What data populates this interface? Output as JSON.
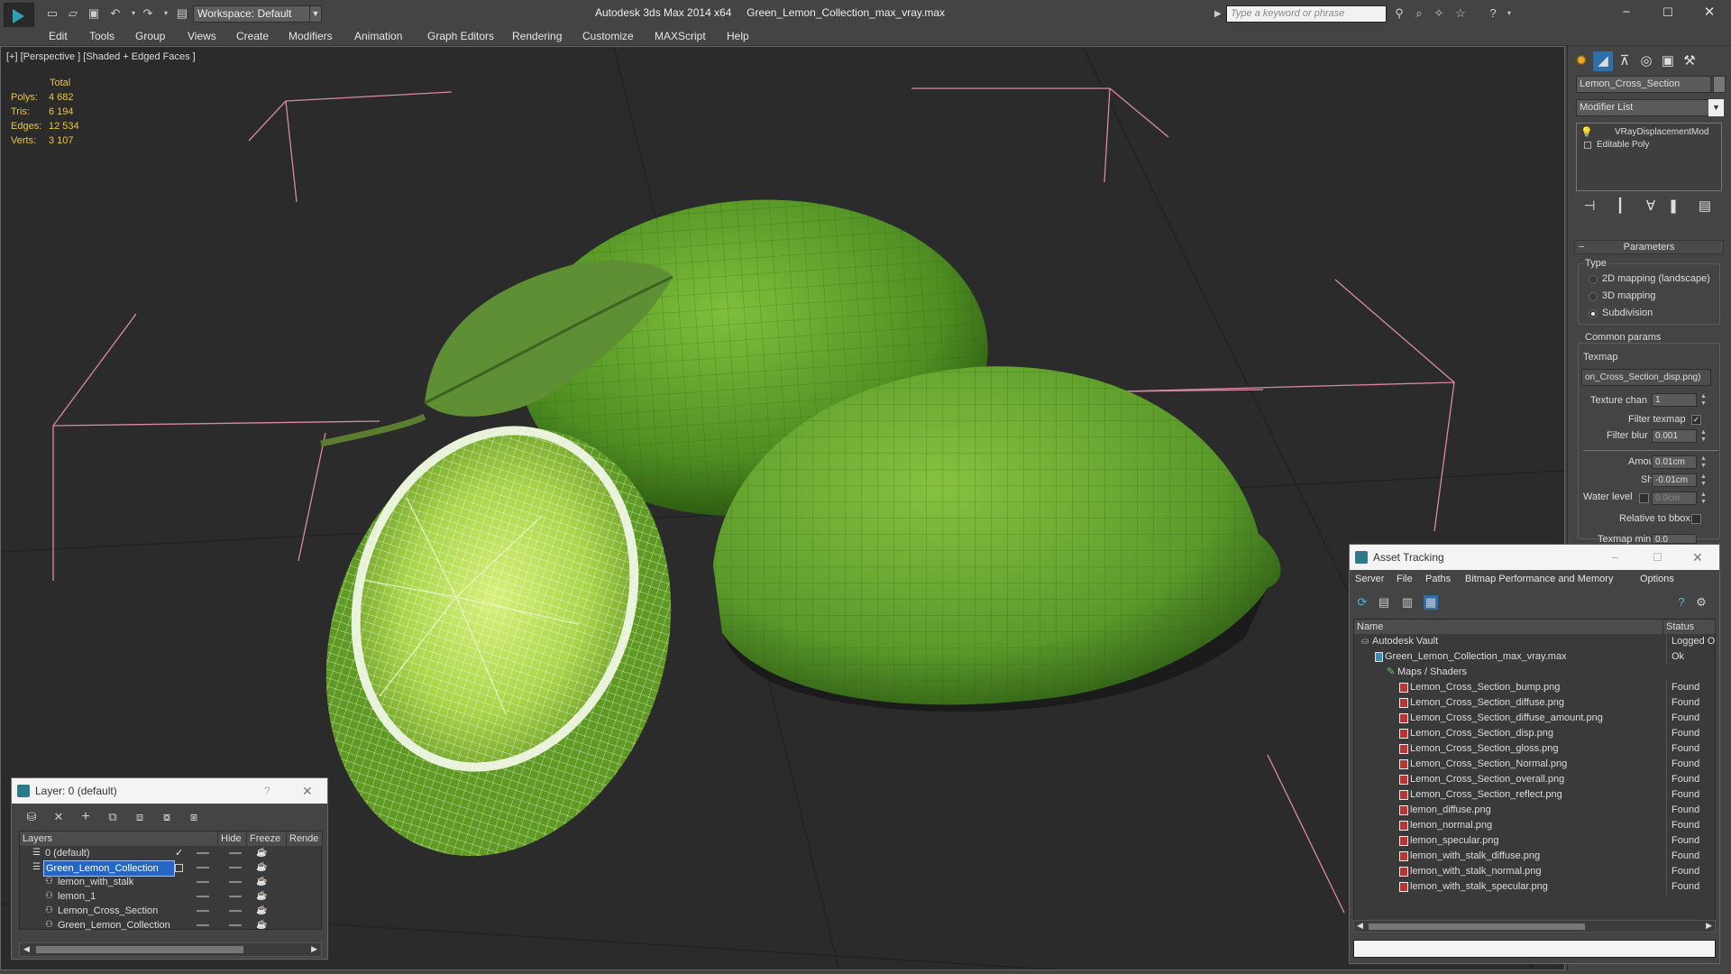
{
  "app": {
    "title": "Autodesk 3ds Max 2014 x64",
    "file": "Green_Lemon_Collection_max_vray.max",
    "workspace": "Workspace: Default",
    "search_placeholder": "Type a keyword or phrase"
  },
  "menu": [
    "Edit",
    "Tools",
    "Group",
    "Views",
    "Create",
    "Modifiers",
    "Animation",
    "Graph Editors",
    "Rendering",
    "Customize",
    "MAXScript",
    "Help"
  ],
  "viewport": {
    "label": "[+] [Perspective ] [Shaded + Edged Faces ]",
    "stats": {
      "header": "Total",
      "rows": [
        {
          "label": "Polys:",
          "value": "4 682"
        },
        {
          "label": "Tris:",
          "value": "6 194"
        },
        {
          "label": "Edges:",
          "value": "12 534"
        },
        {
          "label": "Verts:",
          "value": "3 107"
        }
      ]
    }
  },
  "command_panel": {
    "object_name": "Lemon_Cross_Section",
    "modifier_list": "Modifier List",
    "stack": [
      "VRayDisplacementMod",
      "Editable Poly"
    ],
    "parameters_title": "Parameters",
    "type_label": "Type",
    "type_options": [
      "2D mapping (landscape)",
      "3D mapping",
      "Subdivision"
    ],
    "type_selected": "Subdivision",
    "common_params": "Common params",
    "texmap_label": "Texmap",
    "texmap_value": "on_Cross_Section_disp.png)",
    "texture_chan_label": "Texture chan",
    "texture_chan_value": "1",
    "filter_texmap_label": "Filter texmap",
    "filter_texmap_checked": true,
    "filter_blur_label": "Filter blur",
    "filter_blur_value": "0.001",
    "amount_label": "Amount",
    "amount_value": "0.01cm",
    "shift_label": "Shift",
    "shift_value": "-0.01cm",
    "water_level_label": "Water level",
    "water_level_value": "0.0cm",
    "relative_bbox_label": "Relative to bbox",
    "texmap_min_label": "Texmap min",
    "texmap_min_value": "0.0"
  },
  "layer_dialog": {
    "title": "Layer: 0 (default)",
    "columns": [
      "Layers",
      "Hide",
      "Freeze",
      "Rende"
    ],
    "rows": [
      {
        "name": "0 (default)",
        "indent": 0,
        "selected": false
      },
      {
        "name": "Green_Lemon_Collection",
        "indent": 0,
        "selected": true
      },
      {
        "name": "lemon_with_stalk",
        "indent": 1,
        "selected": false
      },
      {
        "name": "lemon_1",
        "indent": 1,
        "selected": false
      },
      {
        "name": "Lemon_Cross_Section",
        "indent": 1,
        "selected": false
      },
      {
        "name": "Green_Lemon_Collection",
        "indent": 1,
        "selected": false
      }
    ]
  },
  "asset_dialog": {
    "title": "Asset Tracking",
    "menu": [
      "Server",
      "File",
      "Paths",
      "Bitmap Performance and Memory",
      "Options"
    ],
    "columns": [
      "Name",
      "Status"
    ],
    "rows": [
      {
        "name": "Autodesk Vault",
        "status": "Logged O",
        "level": 0
      },
      {
        "name": "Green_Lemon_Collection_max_vray.max",
        "status": "Ok",
        "level": 1
      },
      {
        "name": "Maps / Shaders",
        "status": "",
        "level": 2
      },
      {
        "name": "Lemon_Cross_Section_bump.png",
        "status": "Found",
        "level": 3
      },
      {
        "name": "Lemon_Cross_Section_diffuse.png",
        "status": "Found",
        "level": 3
      },
      {
        "name": "Lemon_Cross_Section_diffuse_amount.png",
        "status": "Found",
        "level": 3
      },
      {
        "name": "Lemon_Cross_Section_disp.png",
        "status": "Found",
        "level": 3
      },
      {
        "name": "Lemon_Cross_Section_gloss.png",
        "status": "Found",
        "level": 3
      },
      {
        "name": "Lemon_Cross_Section_Normal.png",
        "status": "Found",
        "level": 3
      },
      {
        "name": "Lemon_Cross_Section_overall.png",
        "status": "Found",
        "level": 3
      },
      {
        "name": "Lemon_Cross_Section_reflect.png",
        "status": "Found",
        "level": 3
      },
      {
        "name": "lemon_diffuse.png",
        "status": "Found",
        "level": 3
      },
      {
        "name": "lemon_normal.png",
        "status": "Found",
        "level": 3
      },
      {
        "name": "lemon_specular.png",
        "status": "Found",
        "level": 3
      },
      {
        "name": "lemon_with_stalk_diffuse.png",
        "status": "Found",
        "level": 3
      },
      {
        "name": "lemon_with_stalk_normal.png",
        "status": "Found",
        "level": 3
      },
      {
        "name": "lemon_with_stalk_specular.png",
        "status": "Found",
        "level": 3
      }
    ]
  }
}
